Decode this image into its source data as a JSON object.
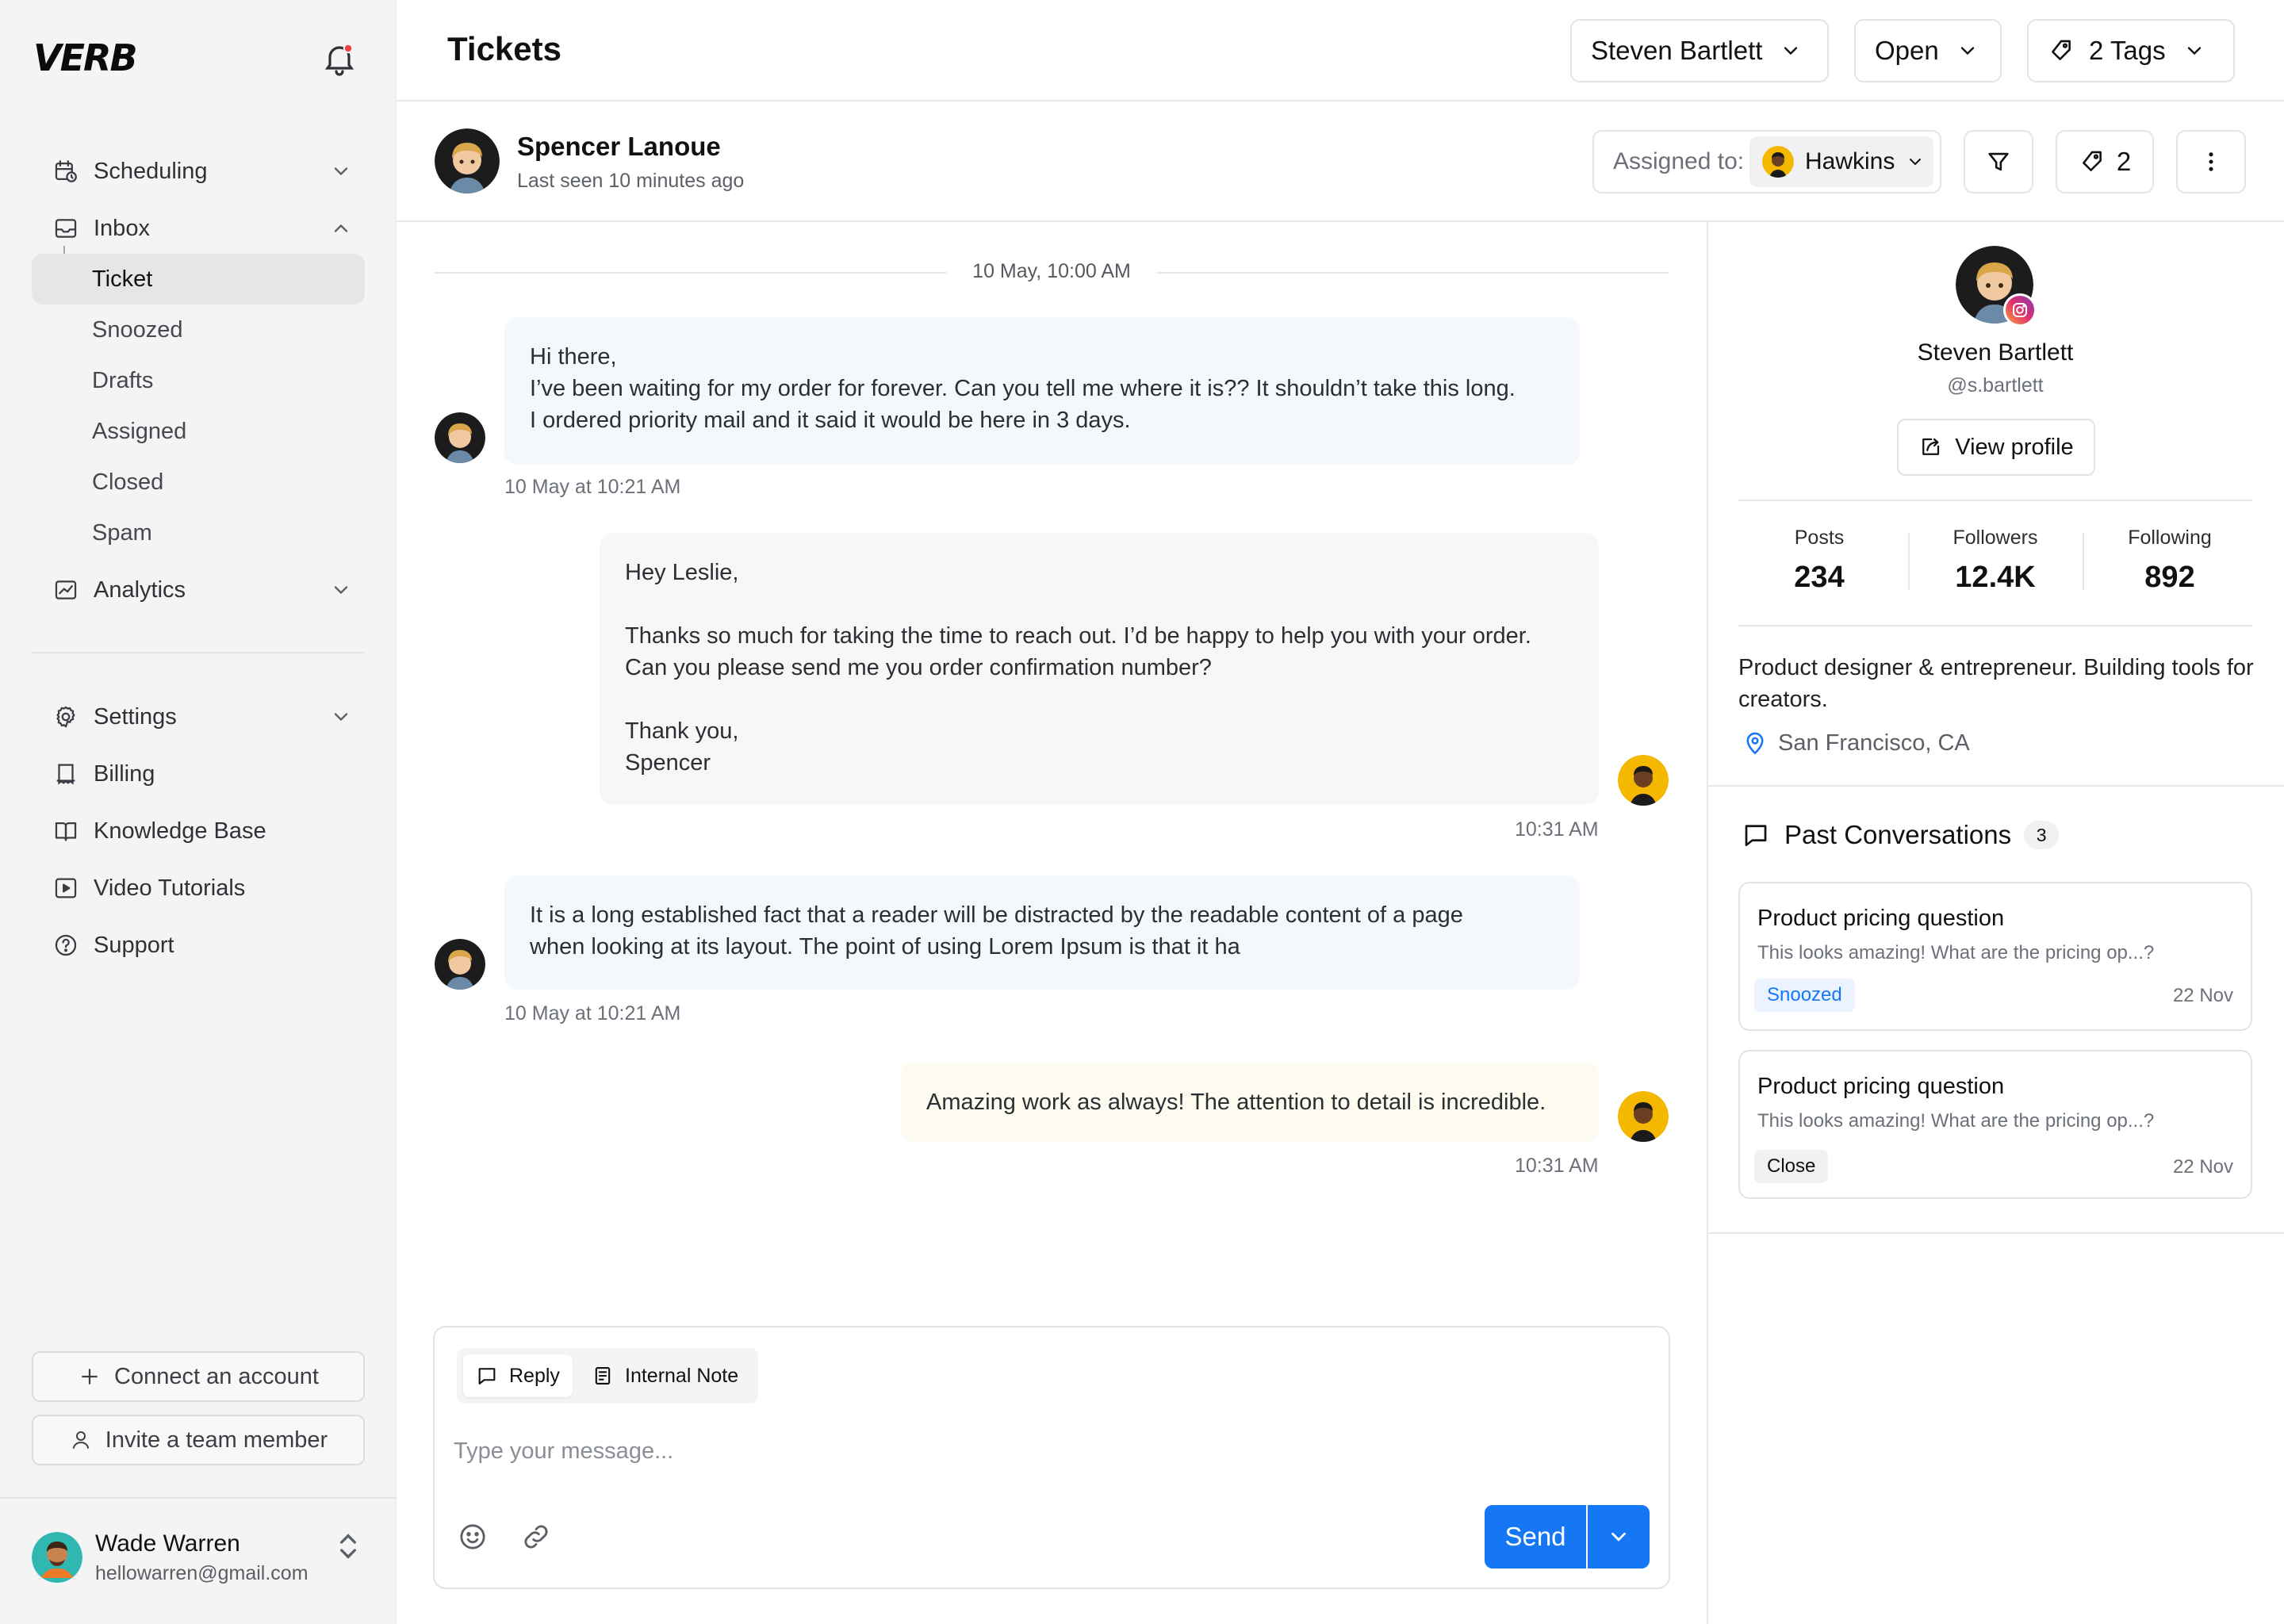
{
  "app": {
    "logo": "VERB"
  },
  "sidebar": {
    "nav": [
      {
        "label": "Scheduling",
        "icon": "calendar-clock-icon"
      },
      {
        "label": "Inbox",
        "icon": "inbox-icon"
      },
      {
        "label": "Analytics",
        "icon": "chart-icon"
      }
    ],
    "inbox_items": [
      {
        "label": "Ticket",
        "active": true
      },
      {
        "label": "Snoozed"
      },
      {
        "label": "Drafts"
      },
      {
        "label": "Assigned"
      },
      {
        "label": "Closed"
      },
      {
        "label": "Spam"
      }
    ],
    "secondary": [
      {
        "label": "Settings",
        "icon": "gear-icon"
      },
      {
        "label": "Billing",
        "icon": "billing-icon"
      },
      {
        "label": "Knowledge Base",
        "icon": "book-icon"
      },
      {
        "label": "Video Tutorials",
        "icon": "play-icon"
      },
      {
        "label": "Support",
        "icon": "help-icon"
      }
    ],
    "connect_label": "Connect an account",
    "invite_label": "Invite a team member",
    "user": {
      "name": "Wade Warren",
      "email": "hellowarren@gmail.com"
    }
  },
  "header": {
    "title": "Tickets",
    "filters": {
      "user": "Steven Bartlett",
      "status": "Open",
      "tags": "2 Tags"
    }
  },
  "conversation": {
    "contact_name": "Spencer Lanoue",
    "last_seen": "Last seen 10 minutes ago",
    "assigned_label": "Assigned to:",
    "assignee": "Hawkins",
    "tag_count": "2",
    "date_separator": "10 May, 10:00 AM",
    "messages": [
      {
        "direction": "in",
        "text": "Hi there,\nI’ve been waiting for my order for forever. Can you tell me where it is?? It shouldn’t take this long.\nI ordered priority mail and it said it would be here in 3 days.",
        "time": "10 May at 10:21 AM"
      },
      {
        "direction": "out",
        "text": "Hey Leslie,\n\nThanks so much for taking the time to reach out. I’d be happy to help you with your order.\nCan you please send me you order confirmation number?\n\nThank you,\nSpencer",
        "time": "10:31 AM"
      },
      {
        "direction": "in",
        "text": "It is a long established fact that a reader will be distracted by the readable content of a page\nwhen looking at its layout. The point of using Lorem Ipsum is that it ha",
        "time": "10 May at 10:21 AM"
      },
      {
        "direction": "note",
        "text": "Amazing work as always! The attention to detail is incredible.",
        "time": "10:31 AM"
      }
    ]
  },
  "composer": {
    "tab_reply": "Reply",
    "tab_note": "Internal Note",
    "placeholder": "Type your message...",
    "send_label": "Send"
  },
  "profile": {
    "name": "Steven Bartlett",
    "handle": "@s.bartlett",
    "view_label": "View profile",
    "stats": [
      {
        "label": "Posts",
        "value": "234"
      },
      {
        "label": "Followers",
        "value": "12.4K"
      },
      {
        "label": "Following",
        "value": "892"
      }
    ],
    "bio": "Product designer & entrepreneur. Building tools for creators.",
    "location": "San Francisco, CA",
    "past_title": "Past Conversations",
    "past_count": "3",
    "past": [
      {
        "title": "Product pricing question",
        "snippet": "This looks amazing! What are the pricing op...?",
        "status": "Snoozed",
        "date": "22 Nov"
      },
      {
        "title": "Product pricing question",
        "snippet": "This looks amazing! What are the pricing op...?",
        "status": "Close",
        "date": "22 Nov"
      }
    ]
  },
  "colors": {
    "accent": "#1677f5",
    "sidebar_bg": "#f4f4f5",
    "incoming_bubble": "#f4f7fc",
    "note_bubble": "#fdfbef"
  }
}
